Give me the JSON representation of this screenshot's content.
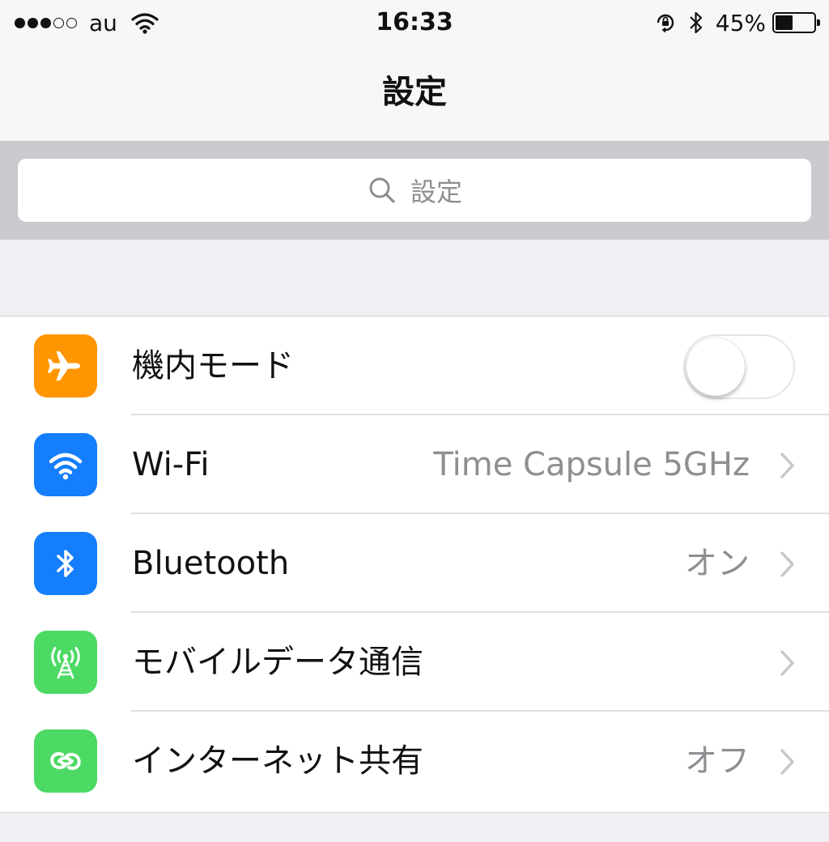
{
  "status_bar": {
    "carrier": "au",
    "time": "16:33",
    "battery_percent": "45%",
    "battery_level": 0.45,
    "signal_strength": {
      "filled": 3,
      "total": 5
    },
    "icons": [
      "signal-dots-icon",
      "wifi-icon",
      "orientation-lock-icon",
      "bluetooth-icon",
      "battery-icon"
    ]
  },
  "nav": {
    "title": "設定"
  },
  "search": {
    "placeholder": "設定"
  },
  "settings": {
    "rows": [
      {
        "label": "機内モード",
        "icon": "airplane-icon",
        "icon_color": "#ff9500",
        "control": "toggle",
        "toggle_on": false
      },
      {
        "label": "Wi-Fi",
        "value": "Time Capsule 5GHz",
        "icon": "wifi-icon",
        "icon_color": "#147efb",
        "control": "chevron"
      },
      {
        "label": "Bluetooth",
        "value": "オン",
        "icon": "bluetooth-icon",
        "icon_color": "#147efb",
        "control": "chevron"
      },
      {
        "label": "モバイルデータ通信",
        "icon": "cellular-antenna-icon",
        "icon_color": "#4cd964",
        "control": "chevron"
      },
      {
        "label": "インターネット共有",
        "value": "オフ",
        "icon": "personal-hotspot-icon",
        "icon_color": "#4cd964",
        "control": "chevron"
      }
    ]
  },
  "colors": {
    "background": "#efeff4",
    "search_band": "#c9c9ce",
    "secondary_text": "#8e8e93",
    "orange": "#ff9500",
    "blue": "#147efb",
    "green": "#4cd964"
  }
}
